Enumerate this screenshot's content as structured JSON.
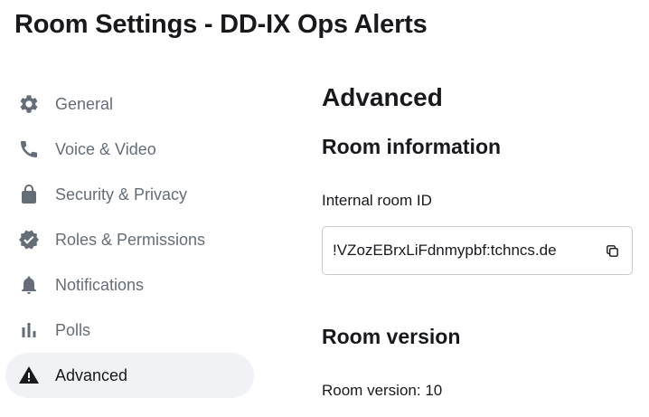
{
  "dialog": {
    "title": "Room Settings - DD-IX Ops Alerts"
  },
  "sidebar": {
    "items": [
      {
        "label": "General",
        "icon": "gear-icon",
        "active": false
      },
      {
        "label": "Voice & Video",
        "icon": "phone-icon",
        "active": false
      },
      {
        "label": "Security & Privacy",
        "icon": "lock-icon",
        "active": false
      },
      {
        "label": "Roles & Permissions",
        "icon": "verified-badge-icon",
        "active": false
      },
      {
        "label": "Notifications",
        "icon": "bell-icon",
        "active": false
      },
      {
        "label": "Polls",
        "icon": "bar-chart-icon",
        "active": false
      },
      {
        "label": "Advanced",
        "icon": "warning-triangle-icon",
        "active": true
      }
    ]
  },
  "main": {
    "title": "Advanced",
    "room_information": {
      "heading": "Room information",
      "internal_id_label": "Internal room ID",
      "internal_id_value": "!VZozEBrxLiFdnmypbf:tchncs.de",
      "copy_icon": "copy-icon"
    },
    "room_version": {
      "heading": "Room version",
      "text": "Room version: 10"
    }
  },
  "colors": {
    "text_primary": "#17191c",
    "text_secondary": "#656d77",
    "active_item_bg": "#f0f2f5",
    "border": "#c6cad0"
  }
}
